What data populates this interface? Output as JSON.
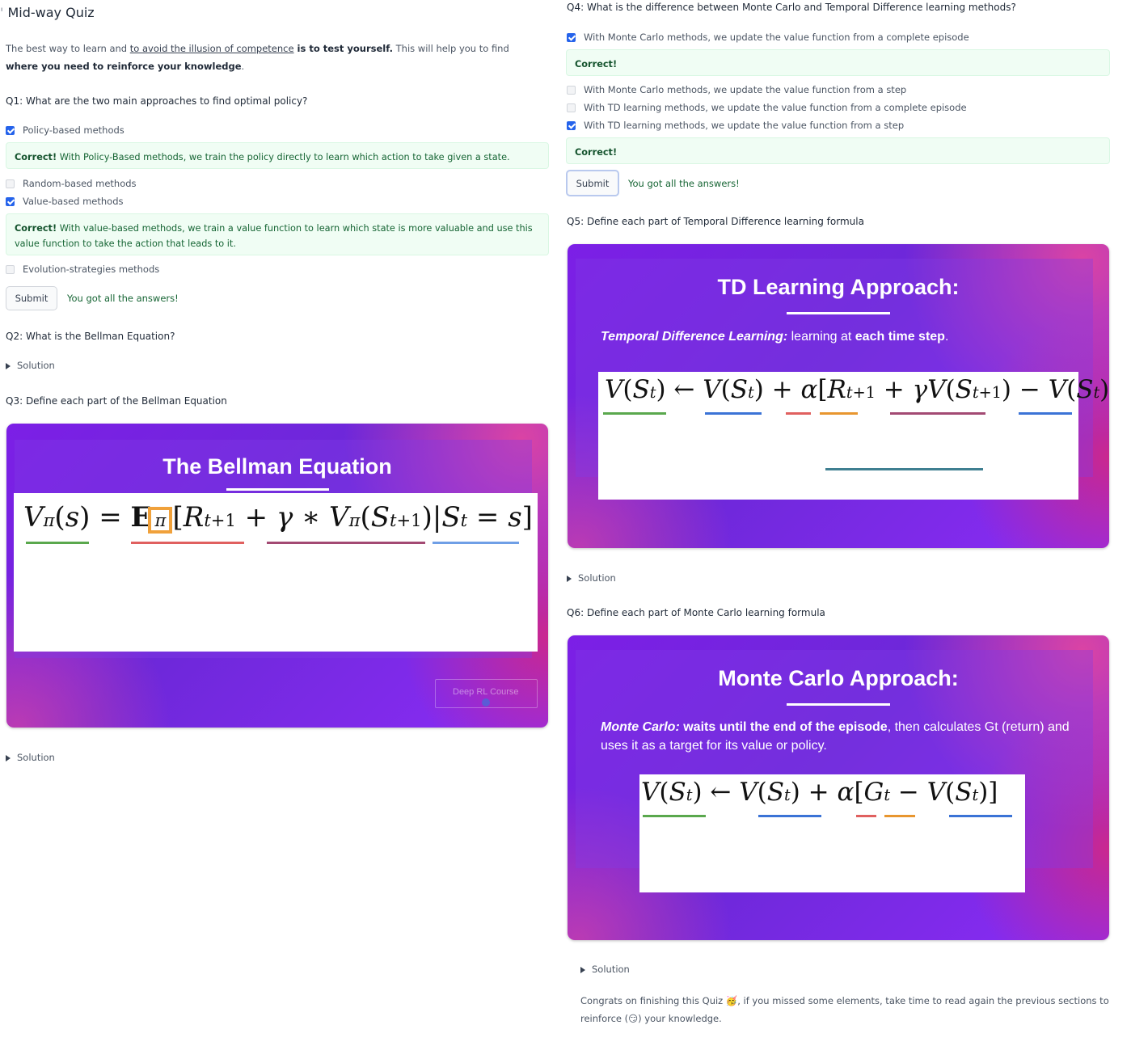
{
  "page_title": "Mid-way Quiz",
  "intro": {
    "part1": "The best way to learn and ",
    "link": "to avoid the illusion of competence",
    "part2": " is to test yourself.",
    "part3": " This will help you to find ",
    "part4": "where you need to reinforce your knowledge",
    "part5": "."
  },
  "q1": {
    "question": "Q1: What are the two main approaches to find optimal policy?",
    "options": [
      {
        "label": "Policy-based methods",
        "checked": true
      },
      {
        "label": "Random-based methods",
        "checked": false
      },
      {
        "label": "Value-based methods",
        "checked": true
      },
      {
        "label": "Evolution-strategies methods",
        "checked": false
      }
    ],
    "feedback1_bold": "Correct!",
    "feedback1_text": " With Policy-Based methods, we train the policy directly to learn which action to take given a state.",
    "feedback2_bold": "Correct!",
    "feedback2_text": " With value-based methods, we train a value function to learn which state is more valuable and use this value function to take the action that leads to it.",
    "submit": "Submit",
    "result": "You got all the answers!"
  },
  "q2": {
    "question": "Q2: What is the Bellman Equation?",
    "solution": "Solution"
  },
  "q3": {
    "question": "Q3: Define each part of the Bellman Equation",
    "slide_title": "The Bellman Equation",
    "watermark": "Deep RL Course",
    "solution": "Solution"
  },
  "q4": {
    "question": "Q4: What is the difference between Monte Carlo and Temporal Difference learning methods?",
    "options": [
      {
        "label": "With Monte Carlo methods, we update the value function from a complete episode",
        "checked": true
      },
      {
        "label": "With Monte Carlo methods, we update the value function from a step",
        "checked": false
      },
      {
        "label": "With TD learning methods, we update the value function from a complete episode",
        "checked": false
      },
      {
        "label": "With TD learning methods, we update the value function from a step",
        "checked": true
      }
    ],
    "feedback1": "Correct!",
    "feedback2": "Correct!",
    "submit": "Submit",
    "result": "You got all the answers!"
  },
  "q5": {
    "question": "Q5: Define each part of Temporal Difference learning formula",
    "slide_title": "TD Learning Approach:",
    "desc_italic": "Temporal Difference Learning:",
    "desc_mid": " learning at ",
    "desc_bold": "each time step",
    "desc_end": ".",
    "solution": "Solution"
  },
  "q6": {
    "question": "Q6: Define each part of Monte Carlo learning formula",
    "slide_title": "Monte Carlo Approach:",
    "desc_italic": "Monte Carlo:",
    "desc_bold": " waits until the end of the episode",
    "desc_end": ", then calculates Gt (return) and uses it as a target for its value or policy.",
    "solution": "Solution"
  },
  "congrats": {
    "part1": "Congrats on finishing this Quiz ",
    "emoji1": "🥳",
    "part2": ", if you missed some elements, take time to read again the previous sections to reinforce (",
    "emoji2": "😏",
    "part3": ") your knowledge."
  },
  "colors": {
    "green": "#5aa84d",
    "blue": "#3b73d6",
    "red": "#e0605f",
    "orange": "#e8962f",
    "maroon": "#a34a73",
    "teal": "#3f7f91",
    "lightblue": "#6f9fe6"
  }
}
